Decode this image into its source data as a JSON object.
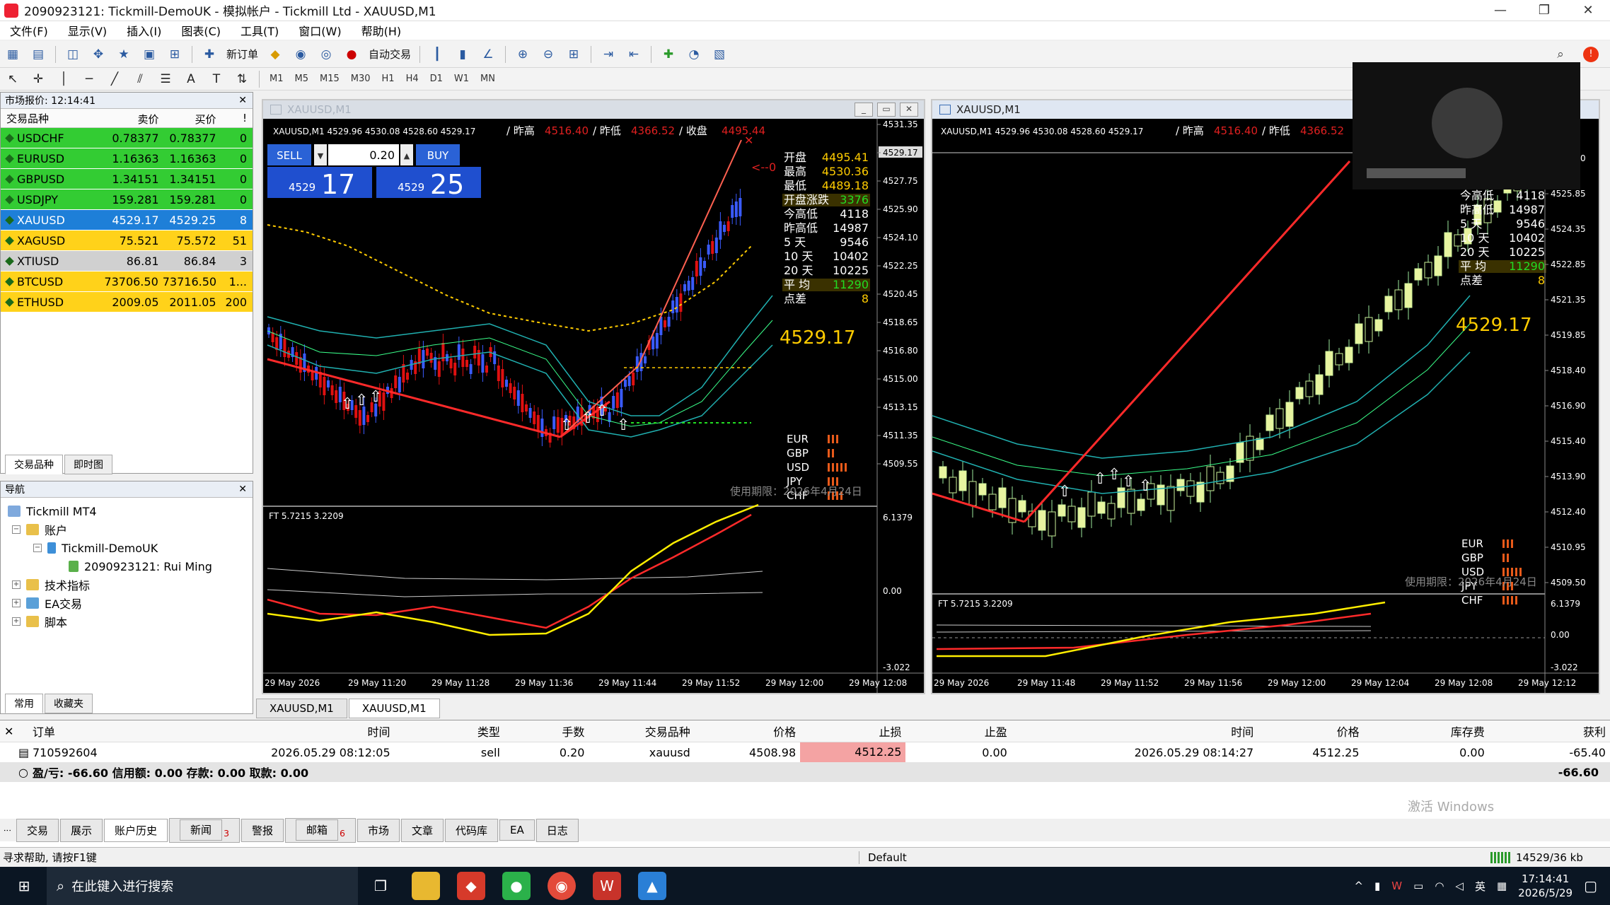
{
  "window": {
    "title": "2090923121: Tickmill-DemoUK - 模拟帐户 - Tickmill Ltd - XAUUSD,M1",
    "controls": [
      "—",
      "❐",
      "✕"
    ]
  },
  "menu": [
    "文件(F)",
    "显示(V)",
    "插入(I)",
    "图表(C)",
    "工具(T)",
    "窗口(W)",
    "帮助(H)"
  ],
  "toolbar": {
    "new_order": "新订单",
    "auto_trade": "自动交易",
    "timeframes": [
      "M1",
      "M5",
      "M15",
      "M30",
      "H1",
      "H4",
      "D1",
      "W1",
      "MN"
    ]
  },
  "market_watch": {
    "title": "市场报价: 12:14:41",
    "columns": [
      "交易品种",
      "卖价",
      "买价",
      "!"
    ],
    "rows": [
      {
        "symbol": "USDCHF",
        "bid": "0.78377",
        "ask": "0.78377",
        "spread": "0",
        "color": "#33cc33"
      },
      {
        "symbol": "EURUSD",
        "bid": "1.16363",
        "ask": "1.16363",
        "spread": "0",
        "color": "#33cc33"
      },
      {
        "symbol": "GBPUSD",
        "bid": "1.34151",
        "ask": "1.34151",
        "spread": "0",
        "color": "#33cc33"
      },
      {
        "symbol": "USDJPY",
        "bid": "159.281",
        "ask": "159.281",
        "spread": "0",
        "color": "#33cc33"
      },
      {
        "symbol": "XAUUSD",
        "bid": "4529.17",
        "ask": "4529.25",
        "spread": "8",
        "color": "#1e7fd8"
      },
      {
        "symbol": "XAGUSD",
        "bid": "75.521",
        "ask": "75.572",
        "spread": "51",
        "color": "#ffd21a"
      },
      {
        "symbol": "XTIUSD",
        "bid": "86.81",
        "ask": "86.84",
        "spread": "3",
        "color": "#d0d0d0"
      },
      {
        "symbol": "BTCUSD",
        "bid": "73706.50",
        "ask": "73716.50",
        "spread": "1...",
        "color": "#ffd21a"
      },
      {
        "symbol": "ETHUSD",
        "bid": "2009.05",
        "ask": "2011.05",
        "spread": "200",
        "color": "#ffd21a"
      }
    ],
    "tabs": [
      "交易品种",
      "即时图"
    ]
  },
  "navigator": {
    "title": "导航",
    "tree": {
      "root": "Tickmill MT4",
      "accounts": "账户",
      "server": "Tickmill-DemoUK",
      "account": "2090923121: Rui Ming",
      "indicators": "技术指标",
      "ea": "EA交易",
      "scripts": "脚本"
    },
    "tabs": [
      "常用",
      "收藏夹"
    ]
  },
  "chart_left": {
    "window_title": "XAUUSD,M1",
    "header": "XAUUSD,M1  4529.96 4530.08 4528.60 4529.17",
    "stats_line": [
      "/ 昨高",
      "4516.40",
      "/ 昨低",
      "4366.52",
      "/ 收盘",
      "4495.44"
    ],
    "one_click": {
      "sell": "SELL",
      "buy": "BUY",
      "lot": "0.20",
      "sell_big": "4529",
      "sell_small": "17",
      "buy_big": "4529",
      "buy_small": "25"
    },
    "arrow_label": "<--0",
    "info": [
      {
        "k": "开盘",
        "v": "4495.41"
      },
      {
        "k": "最高",
        "v": "4530.36"
      },
      {
        "k": "最低",
        "v": "4489.18"
      },
      {
        "k": "开盘涨跌",
        "v": "3376"
      },
      {
        "k": "今高低",
        "v": "4118"
      },
      {
        "k": "昨高低",
        "v": "14987"
      },
      {
        "k": "5  天",
        "v": "9546"
      },
      {
        "k": "10 天",
        "v": "10402"
      },
      {
        "k": "20 天",
        "v": "10225"
      },
      {
        "k": "平 均",
        "v": "11290"
      },
      {
        "k": "点差",
        "v": "8"
      }
    ],
    "price_big": "4529.17",
    "currencies": [
      "EUR",
      "GBP",
      "USD",
      "JPY",
      "CHF"
    ],
    "expiry": "使用期限：2026年4月24日",
    "price_axis": [
      "4531.35",
      "4529.17",
      "4527.75",
      "4525.90",
      "4524.10",
      "4522.25",
      "4520.45",
      "4518.65",
      "4516.80",
      "4515.00",
      "4513.15",
      "4511.35",
      "4509.55"
    ],
    "indicator_label": "FT 5.7215 3.2209",
    "indicator_axis": [
      "6.1379",
      "0.00",
      "-3.022"
    ],
    "time_axis": [
      "29 May 2026",
      "29 May 11:20",
      "29 May 11:28",
      "29 May 11:36",
      "29 May 11:44",
      "29 May 11:52",
      "29 May 12:00",
      "29 May 12:08"
    ]
  },
  "chart_right": {
    "window_title": "XAUUSD,M1",
    "header": "XAUUSD,M1  4529.96 4530.08 4528.60 4529.17",
    "stats_line": [
      "/ 昨高",
      "4516.40",
      "/ 昨低",
      "4366.52"
    ],
    "info": [
      {
        "k": "今高低",
        "v": "4118"
      },
      {
        "k": "昨高低",
        "v": "14987"
      },
      {
        "k": "5  天",
        "v": "9546"
      },
      {
        "k": "10 天",
        "v": "10402"
      },
      {
        "k": "20 天",
        "v": "10225"
      },
      {
        "k": "平 均",
        "v": "11290"
      },
      {
        "k": "点差",
        "v": "8"
      }
    ],
    "price_big": "4529.17",
    "currencies": [
      "EUR",
      "GBP",
      "USD",
      "JPY",
      "CHF"
    ],
    "expiry": "使用期限：2026年4月24日",
    "price_axis": [
      "4527.30",
      "4525.85",
      "4524.35",
      "4522.85",
      "4521.35",
      "4519.85",
      "4518.40",
      "4516.90",
      "4515.40",
      "4513.90",
      "4512.40",
      "4510.95",
      "4509.50"
    ],
    "indicator_label": "FT 5.7215 3.2209",
    "indicator_axis": [
      "6.1379",
      "0.00",
      "-3.022"
    ],
    "time_axis": [
      "29 May 2026",
      "29 May 11:48",
      "29 May 11:52",
      "29 May 11:56",
      "29 May 12:00",
      "29 May 12:04",
      "29 May 12:08",
      "29 May 12:12"
    ]
  },
  "chart_tabs": [
    "XAUUSD,M1",
    "XAUUSD,M1"
  ],
  "terminal": {
    "columns": [
      "订单",
      "时间",
      "类型",
      "手数",
      "交易品种",
      "价格",
      "止损",
      "止盈",
      "时间",
      "价格",
      "库存费",
      "获利"
    ],
    "order": {
      "id": "710592604",
      "open_time": "2026.05.29 08:12:05",
      "type": "sell",
      "lots": "0.20",
      "symbol": "xauusd",
      "price": "4508.98",
      "sl": "4512.25",
      "tp": "0.00",
      "close_time": "2026.05.29 08:14:27",
      "close_price": "4512.25",
      "swap": "0.00",
      "profit": "-65.40"
    },
    "summary": "盈/亏: -66.60  信用额: 0.00  存款: 0.00  取款: 0.00",
    "summary_total": "-66.60",
    "tabs": [
      "交易",
      "展示",
      "账户历史",
      "新闻",
      "警报",
      "邮箱",
      "市场",
      "文章",
      "代码库",
      "EA",
      "日志"
    ],
    "news_count": "3",
    "mail_count": "6",
    "watermark": "激活 Windows"
  },
  "status_bar": {
    "help": "寻求帮助, 请按F1键",
    "profile": "Default",
    "traffic": "14529/36 kb"
  },
  "taskbar": {
    "search_placeholder": "在此键入进行搜索",
    "ime": "英",
    "time": "17:14:41",
    "date": "2026/5/29"
  }
}
